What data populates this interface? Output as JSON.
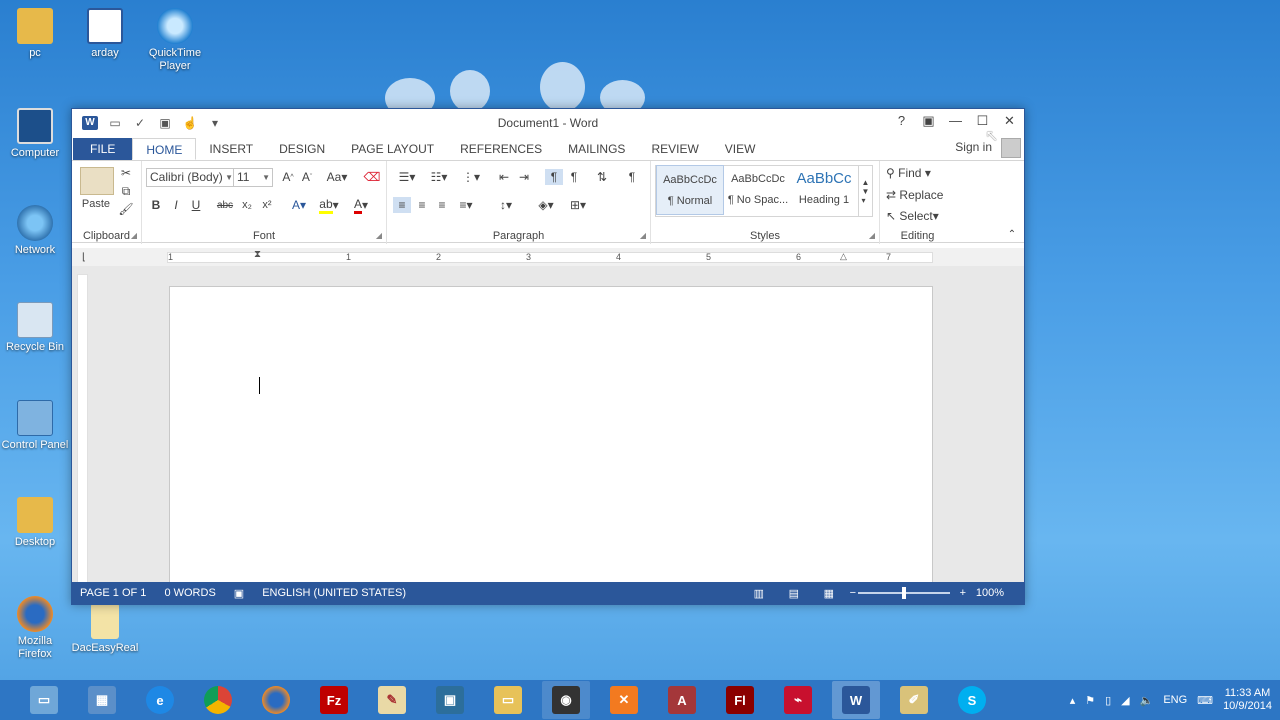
{
  "desktop": {
    "icons": [
      {
        "label": "pc"
      },
      {
        "label": "arday"
      },
      {
        "label": "QuickTime Player"
      },
      {
        "label": "Computer"
      },
      {
        "label": "Network"
      },
      {
        "label": "Recycle Bin"
      },
      {
        "label": "Control Panel"
      },
      {
        "label": "Desktop"
      },
      {
        "label": "Mozilla Firefox"
      },
      {
        "label": "DacEasyReal"
      }
    ]
  },
  "window": {
    "title": "Document1 - Word",
    "help": "?",
    "sign_in": "Sign in",
    "tabs": [
      "FILE",
      "HOME",
      "INSERT",
      "DESIGN",
      "PAGE LAYOUT",
      "REFERENCES",
      "MAILINGS",
      "REVIEW",
      "VIEW"
    ],
    "active_tab": "HOME"
  },
  "ribbon": {
    "clipboard": {
      "paste": "Paste",
      "label": "Clipboard"
    },
    "font": {
      "family": "Calibri (Body)",
      "size": "11",
      "label": "Font",
      "bold": "B",
      "italic": "I",
      "underline": "U",
      "strike": "abc",
      "sub": "x₂",
      "sup": "x²",
      "case": "Aa"
    },
    "paragraph": {
      "label": "Paragraph"
    },
    "styles": {
      "label": "Styles",
      "items": [
        {
          "preview": "AaBbCcDc",
          "name": "¶ Normal"
        },
        {
          "preview": "AaBbCcDc",
          "name": "¶ No Spac..."
        },
        {
          "preview": "AaBbCc",
          "name": "Heading 1"
        }
      ]
    },
    "editing": {
      "find": "Find",
      "replace": "Replace",
      "select": "Select",
      "label": "Editing"
    }
  },
  "ruler": {
    "ticks": [
      "1",
      "1",
      "2",
      "3",
      "4",
      "5",
      "6",
      "7"
    ]
  },
  "status": {
    "page": "PAGE 1 OF 1",
    "words": "0 WORDS",
    "language": "ENGLISH (UNITED STATES)",
    "zoom": "100%",
    "zoom_level": 0.5
  },
  "taskbar": {
    "time": "11:33 AM",
    "date": "10/9/2014",
    "lang": "ENG"
  },
  "colors": {
    "accent": "#2b579a"
  }
}
